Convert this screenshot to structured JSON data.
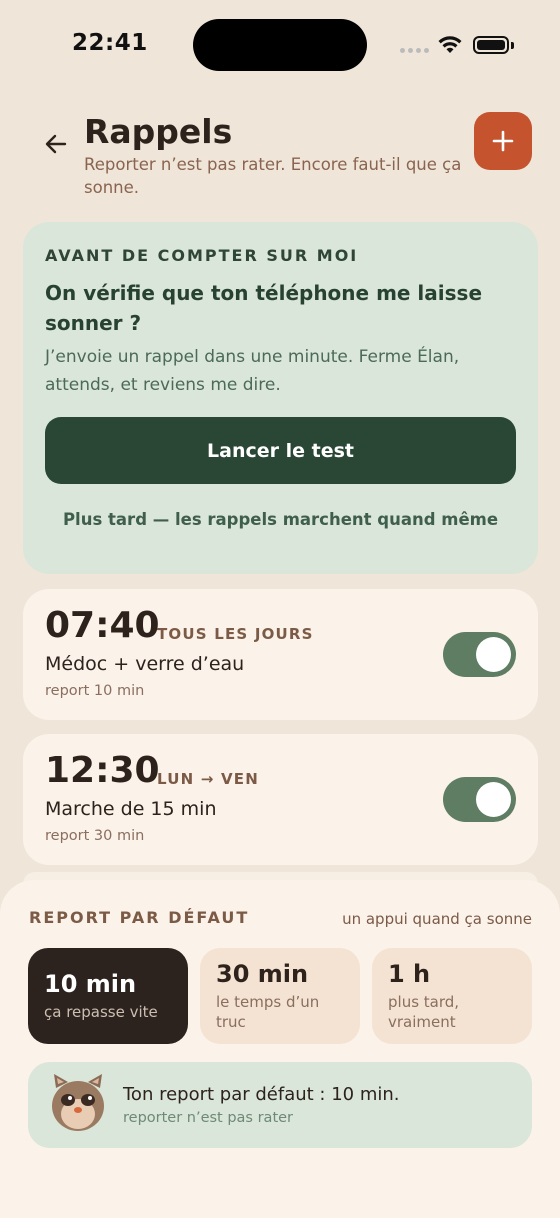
{
  "status": {
    "time": "22:41"
  },
  "header": {
    "title": "Rappels",
    "subtitle": "Reporter n’est pas rater. Encore faut-il que ça sonne."
  },
  "test_card": {
    "eyebrow": "AVANT DE COMPTER SUR MOI",
    "title": "On vérifie que ton téléphone me laisse sonner ?",
    "body": "J’envoie un rappel dans une minute. Ferme Élan, attends, et reviens me dire.",
    "button_label": "Lancer le test",
    "later_label": "Plus tard — les rappels marchent quand même"
  },
  "reminders": [
    {
      "time": "07:40",
      "days": "TOUS LES JOURS",
      "label": "Médoc + verre d’eau",
      "snooze": "report 10 min",
      "enabled": true
    },
    {
      "time": "12:30",
      "days": "LUN → VEN",
      "label": "Marche de 15 min",
      "snooze": "report 30 min",
      "enabled": true
    }
  ],
  "snooze_sheet": {
    "heading": "REPORT PAR DÉFAUT",
    "hint": "un appui quand ça sonne",
    "options": [
      {
        "value": "10 min",
        "desc": "ça repasse vite",
        "selected": true
      },
      {
        "value": "30 min",
        "desc": "le temps d’un truc",
        "selected": false
      },
      {
        "value": "1 h",
        "desc": "plus tard, vraiment",
        "selected": false
      }
    ],
    "banner_title": "Ton report par défaut : 10 min.",
    "banner_sub": "reporter n’est pas rater"
  },
  "colors": {
    "background": "#efe5d8",
    "accent": "#c4532e",
    "green_dark": "#2a4635",
    "green_light": "#dae6da",
    "toggle_on": "#5e7d63"
  },
  "icons": [
    "back-arrow-icon",
    "plus-icon",
    "wifi-icon",
    "battery-icon",
    "mascot-icon"
  ]
}
